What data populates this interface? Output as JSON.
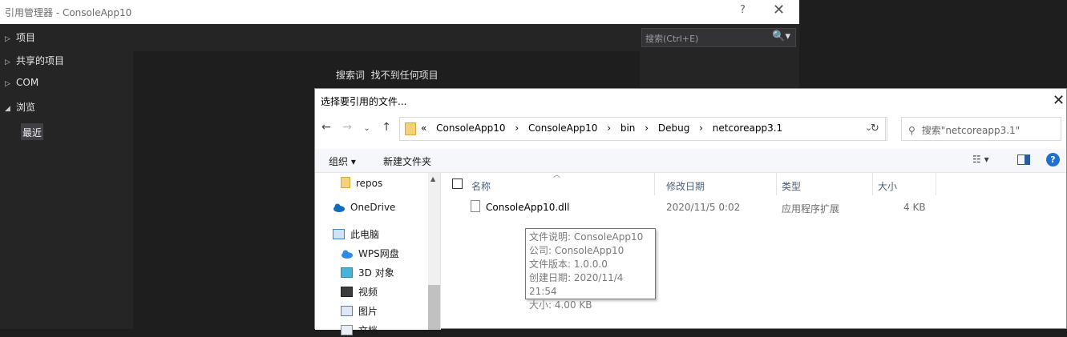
{
  "ref_manager": {
    "title": "引用管理器 - ConsoleApp10",
    "help": "?",
    "close": "✕",
    "nav": [
      {
        "label": "项目",
        "arrow": "▷"
      },
      {
        "label": "共享的项目",
        "arrow": "▷"
      },
      {
        "label": "COM",
        "arrow": "▷"
      },
      {
        "label": "浏览",
        "arrow": "◢"
      }
    ],
    "nav_selected": "最近",
    "search_placeholder": "搜索(Ctrl+E)",
    "search_icon": "🔍▾",
    "search_term_label": "搜索词",
    "no_results": "找不到任何项目"
  },
  "dialog": {
    "title": "选择要引用的文件...",
    "close": "✕",
    "nav": {
      "back": "←",
      "forward": "→",
      "recent": "⌄",
      "up": "↑"
    },
    "breadcrumb": [
      "«",
      "ConsoleApp10",
      "›",
      "ConsoleApp10",
      "›",
      "bin",
      "›",
      "Debug",
      "›",
      "netcoreapp3.1"
    ],
    "address_dropdown": "⌄",
    "refresh": "↻",
    "search_placeholder": "搜索\"netcoreapp3.1\"",
    "toolbar": {
      "organize": "组织 ▾",
      "new_folder": "新建文件夹",
      "view": "☷ ▾",
      "help": "?"
    },
    "tree": [
      {
        "label": "repos",
        "icon": "folder-icon"
      },
      {
        "label": "OneDrive",
        "icon": "cloud-icon"
      },
      {
        "label": "此电脑",
        "icon": "computer-icon"
      },
      {
        "label": "WPS网盘",
        "icon": "cloud-icon"
      },
      {
        "label": "3D 对象",
        "icon": "cube-icon"
      },
      {
        "label": "视频",
        "icon": "video-icon"
      },
      {
        "label": "图片",
        "icon": "picture-icon"
      },
      {
        "label": "文档",
        "icon": "document-icon"
      }
    ],
    "columns": {
      "name": "名称",
      "date": "修改日期",
      "type": "类型",
      "size": "大小"
    },
    "files": [
      {
        "name": "ConsoleApp10.dll",
        "date": "2020/11/5 0:02",
        "type": "应用程序扩展",
        "size": "4 KB"
      }
    ],
    "tooltip": [
      "文件说明: ConsoleApp10",
      "公司: ConsoleApp10",
      "文件版本: 1.0.0.0",
      "创建日期: 2020/11/4 21:54",
      "大小: 4.00 KB"
    ]
  }
}
